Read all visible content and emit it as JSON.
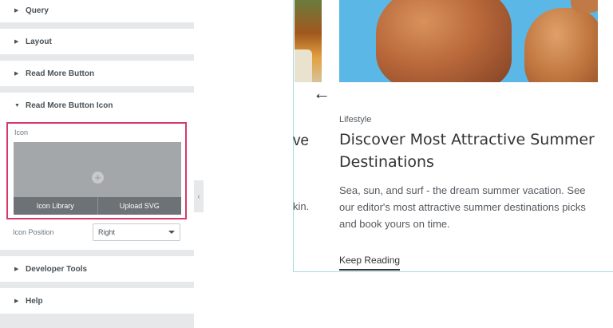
{
  "panel": {
    "sections": {
      "query": "Query",
      "layout": "Layout",
      "read_more_button": "Read More Button",
      "read_more_button_icon": "Read More Button Icon",
      "developer_tools": "Developer Tools",
      "help": "Help"
    },
    "icon_control": {
      "label": "Icon",
      "icon_library": "Icon Library",
      "upload_svg": "Upload SVG"
    },
    "icon_position": {
      "label": "Icon Position",
      "value": "Right"
    }
  },
  "preview": {
    "prev_card": {
      "title_fragment": "ve",
      "text_fragment": "kin."
    },
    "card": {
      "category": "Lifestyle",
      "title": "Discover Most Attractive Summer Destinations",
      "excerpt": "Sea, sun, and surf - the dream summer vacation. See our editor's most attractive summer destinations picks and book yours on time.",
      "read_more": "Keep Reading"
    }
  },
  "colors": {
    "highlight": "#d63a6b",
    "panel_bg": "#e6e8ea",
    "sky": "#5ab7e6"
  }
}
